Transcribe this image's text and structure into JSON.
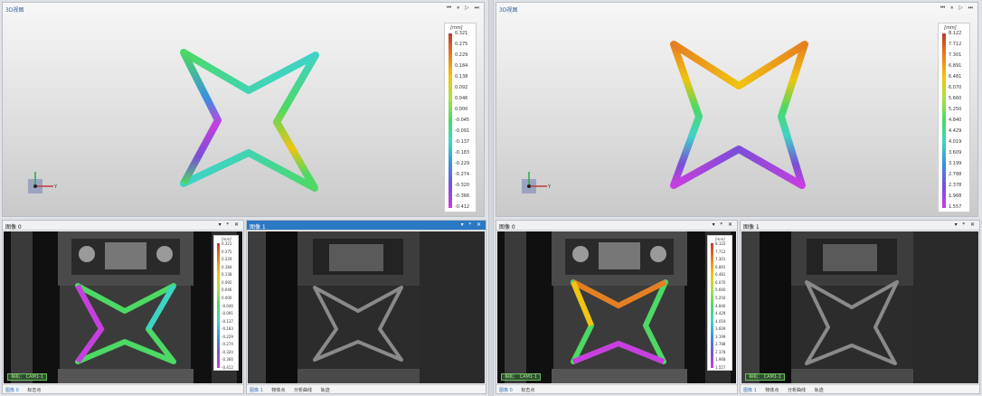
{
  "left": {
    "view3d": {
      "title": "3D视图",
      "tools": "⏮ ⏸ ▷ ⏭",
      "colorbar": {
        "unit": "[mm]",
        "ticks": [
          "0.321",
          "0.275",
          "0.229",
          "0.184",
          "0.138",
          "0.092",
          "0.046",
          "0.000",
          "-0.045",
          "-0.091",
          "-0.137",
          "-0.183",
          "-0.229",
          "-0.274",
          "-0.320",
          "-0.366",
          "-0.412"
        ]
      },
      "axis_label": "Y"
    },
    "pane0": {
      "title": "图像 0",
      "controls": "▾ ᵠ ✕",
      "cam": "相机： CAM1-1",
      "footer": [
        "图像 0",
        "标志点"
      ],
      "colorbar": {
        "unit": "[mm]",
        "ticks": [
          "0.321",
          "0.275",
          "0.229",
          "0.184",
          "0.138",
          "0.092",
          "0.046",
          "0.000",
          "-0.046",
          "-0.091",
          "-0.137",
          "-0.183",
          "-0.229",
          "-0.274",
          "-0.320",
          "-0.366",
          "-0.412"
        ]
      }
    },
    "pane1": {
      "title": "图像 1",
      "controls": "▾ ᵠ ✕",
      "footer": [
        "图像 1",
        "物体点",
        "分析曲线",
        "轨迹"
      ]
    }
  },
  "right": {
    "view3d": {
      "title": "3D视图",
      "tools": "⏮ ⏸ ▷ ⏭",
      "colorbar": {
        "unit": "[mm]",
        "ticks": [
          "8.122",
          "7.712",
          "7.301",
          "6.891",
          "6.481",
          "6.070",
          "5.660",
          "5.250",
          "4.840",
          "4.429",
          "4.019",
          "3.609",
          "3.199",
          "2.788",
          "2.378",
          "1.968",
          "1.557"
        ]
      },
      "axis_label": "Y"
    },
    "pane0": {
      "title": "图像 0",
      "controls": "▾ ᵠ ✕",
      "cam": "相机： CAM1-1",
      "footer": [
        "图像 0",
        "标志点"
      ],
      "colorbar": {
        "unit": "[mm]",
        "ticks": [
          "8.122",
          "7.712",
          "7.301",
          "6.891",
          "6.481",
          "6.070",
          "5.660",
          "5.250",
          "4.840",
          "4.429",
          "4.019",
          "3.609",
          "3.199",
          "2.788",
          "2.378",
          "1.968",
          "1.557"
        ]
      }
    },
    "pane1": {
      "title": "图像 1",
      "controls": "▾ ᵠ ✕",
      "cam": "相机： CAM1-1",
      "footer": [
        "图像 1",
        "物体点",
        "分析曲线",
        "轨迹"
      ]
    }
  },
  "colors": {
    "active_tab": "#2b78c4",
    "colormap": [
      "#c0392b",
      "#e67e22",
      "#f1c40f",
      "#a8e04a",
      "#4cd964",
      "#3fd3c6",
      "#3b8fe0",
      "#7a4fd6",
      "#c83ee0"
    ]
  }
}
